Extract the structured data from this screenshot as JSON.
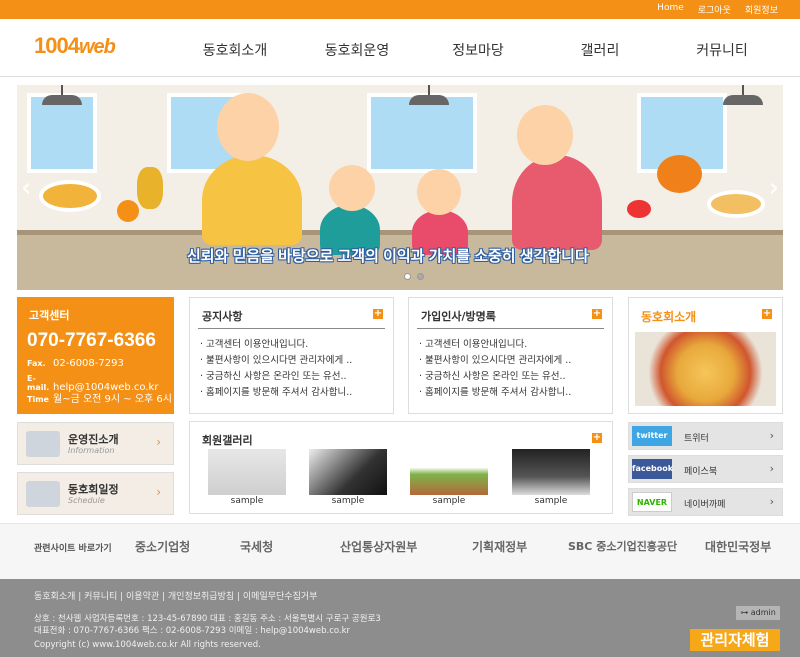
{
  "topbar": {
    "links": [
      "Home",
      "로그아웃",
      "회원정보"
    ]
  },
  "logo": {
    "part1": "100",
    "part2": "4",
    "part3": "web"
  },
  "nav": [
    "동호회소개",
    "동호회운영",
    "정보마당",
    "갤러리",
    "커뮤니티"
  ],
  "hero": {
    "slogan": "신뢰와 믿음을 바탕으로 고객의 이익과 가치를 소중히 생각합니다"
  },
  "customer_center": {
    "title": "고객센터",
    "phone": "070-7767-6366",
    "fax_label": "Fax.",
    "fax": "02-6008-7293",
    "email_label": "E-mail.",
    "email": "help@1004web.co.kr",
    "time_label": "Time",
    "time": "월~금 오전 9시 ~ 오후 6시"
  },
  "side_buttons": [
    {
      "title": "운영진소개",
      "sub": "Information"
    },
    {
      "title": "동호회일정",
      "sub": "Schedule"
    }
  ],
  "notice": {
    "title": "공지사항",
    "items": [
      "고객센터 이용안내입니다.",
      "불편사항이 있으시다면 관리자에게 ..",
      "궁금하신 사항은 온라인 또는 유선..",
      "홈페이지를 방문해 주셔서 감사합니.."
    ]
  },
  "guestbook": {
    "title": "가입인사/방명록",
    "items": [
      "고객센터 이용안내입니다.",
      "불편사항이 있으시다면 관리자에게 ..",
      "궁금하신 사항은 온라인 또는 유선..",
      "홈페이지를 방문해 주셔서 감사합니.."
    ]
  },
  "gallery": {
    "title": "회원갤러리",
    "captions": [
      "sample",
      "sample",
      "sample",
      "sample"
    ]
  },
  "club": {
    "title": "동호회소개"
  },
  "sns": [
    {
      "logo": "twitter",
      "label": "트위터"
    },
    {
      "logo": "facebook",
      "label": "페이스북"
    },
    {
      "logo": "NAVER",
      "label": "네이버까페"
    }
  ],
  "partners": {
    "label": "관련사이트 바로가기",
    "names": [
      "중소기업청",
      "국세청",
      "산업통상자원부",
      "기획재정부",
      "SBC 중소기업진흥공단",
      "대한민국정부"
    ]
  },
  "footer": {
    "links": "동호회소개 | 커뮤니티 | 이용약관 | 개인정보취급방침 | 이메일무단수집거부",
    "line1": "상호 : 천사웹  사업자등록번호 : 123-45-67890  대표 : 홍길동  주소 : 서울특별시 구로구 공원로3",
    "line2": "대표전화 : 070-7767-6366  팩스 : 02-6008-7293  이메일 : help@1004web.co.kr",
    "copyright": "Copyright (c) www.1004web.co.kr All rights reserved.",
    "admin": "admin",
    "demo": "관리자체험"
  },
  "colors": {
    "accent": "#f39015",
    "footer_bg": "#8d8d8d"
  }
}
